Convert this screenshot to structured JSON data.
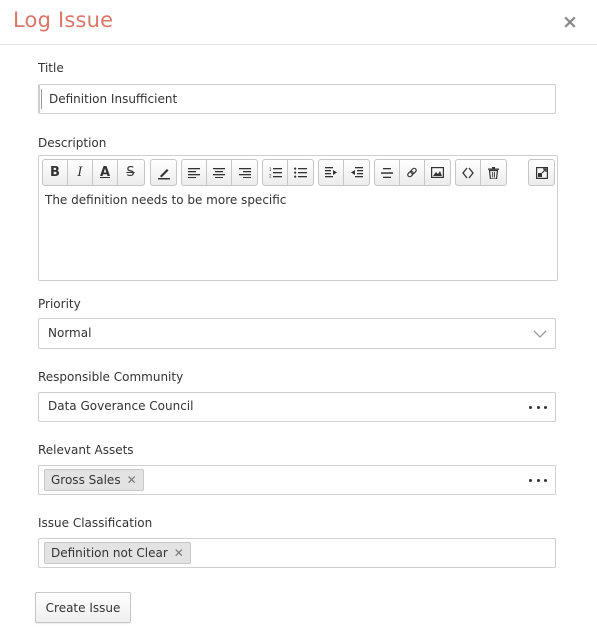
{
  "dialog": {
    "title": "Log Issue",
    "close_glyph": "×"
  },
  "form": {
    "title": {
      "label": "Title",
      "value": "Definition Insufficient"
    },
    "description": {
      "label": "Description",
      "value": "The definition needs to be more specific",
      "toolbar_icons": [
        "bold-icon",
        "italic-icon",
        "font-color-icon",
        "strikethrough-icon",
        "highlight-icon",
        "align-left-icon",
        "align-center-icon",
        "align-right-icon",
        "numbered-list-icon",
        "bullet-list-icon",
        "indent-icon",
        "outdent-icon",
        "horizontal-rule-icon",
        "link-icon",
        "image-icon",
        "source-code-icon",
        "delete-icon",
        "fullscreen-icon"
      ],
      "toolbar_glyphs": {
        "bold": "B",
        "italic": "I",
        "font_color": "A",
        "strike": "S"
      }
    },
    "priority": {
      "label": "Priority",
      "value": "Normal"
    },
    "community": {
      "label": "Responsible Community",
      "value": "Data Goverance Council"
    },
    "assets": {
      "label": "Relevant Assets",
      "tags": [
        "Gross Sales"
      ]
    },
    "classification": {
      "label": "Issue Classification",
      "tags": [
        "Definition not Clear"
      ]
    }
  },
  "actions": {
    "create_label": "Create Issue"
  },
  "colors": {
    "title_accent": "#d9776a",
    "border": "#cfcfcf",
    "tag_bg": "#e3e3e3"
  }
}
